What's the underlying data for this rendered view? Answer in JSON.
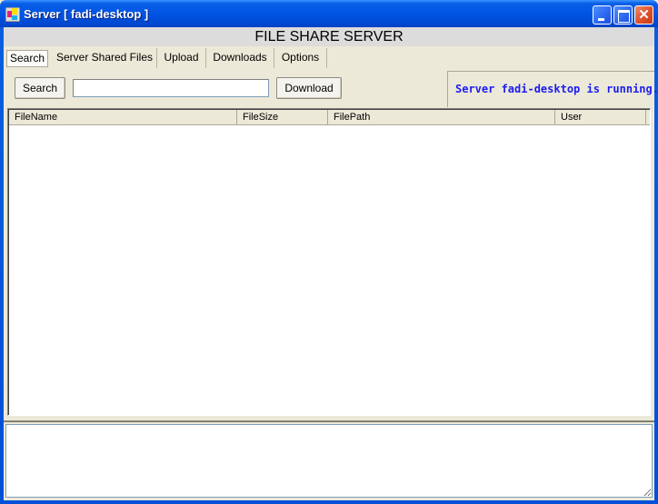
{
  "window": {
    "title": "Server [ fadi-desktop ]",
    "icon": "app-window-icon",
    "controls": {
      "minimize": "minimize-icon",
      "maximize": "maximize-icon",
      "close_glyph": "✕"
    }
  },
  "header": {
    "title": "FILE SHARE SERVER"
  },
  "tabs": [
    {
      "label": "Search",
      "active": true
    },
    {
      "label": "Server Shared Files",
      "active": false
    },
    {
      "label": "Upload",
      "active": false
    },
    {
      "label": "Downloads",
      "active": false
    },
    {
      "label": "Options",
      "active": false
    }
  ],
  "search_panel": {
    "search_button_label": "Search",
    "search_input_value": "",
    "download_button_label": "Download"
  },
  "status": {
    "text": "Server fadi-desktop is running..",
    "color": "#1c1cf0"
  },
  "results_table": {
    "columns": [
      "FileName",
      "FileSize",
      "FilePath",
      "User"
    ],
    "rows": []
  },
  "log": {
    "text": ""
  }
}
